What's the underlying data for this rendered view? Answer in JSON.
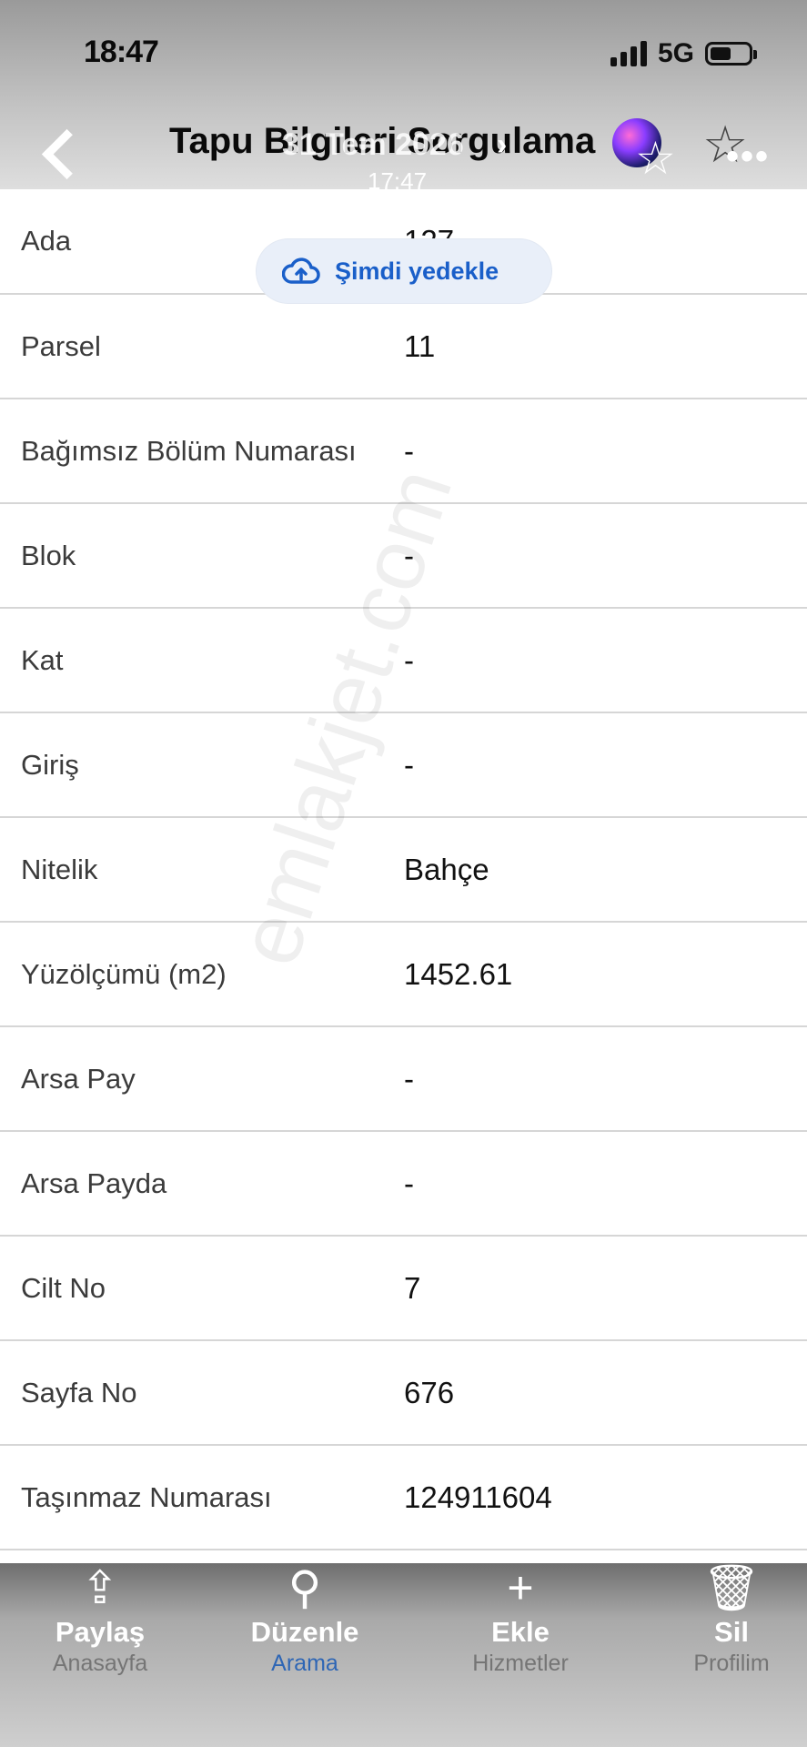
{
  "status": {
    "time": "18:47",
    "network": "5G"
  },
  "header": {
    "title": "Tapu Bilgileri Sorgulama",
    "overlay_date": "31 Tem 2026",
    "overlay_time": "17:47"
  },
  "backup": {
    "label": "Şimdi yedekle"
  },
  "rows": [
    {
      "label": "Ada",
      "value": "127"
    },
    {
      "label": "Parsel",
      "value": "11"
    },
    {
      "label": "Bağımsız Bölüm Numarası",
      "value": "-"
    },
    {
      "label": "Blok",
      "value": "-"
    },
    {
      "label": "Kat",
      "value": "-"
    },
    {
      "label": "Giriş",
      "value": "-"
    },
    {
      "label": "Nitelik",
      "value": "Bahçe"
    },
    {
      "label": "Yüzölçümü (m2)",
      "value": "1452.61"
    },
    {
      "label": "Arsa Pay",
      "value": "-"
    },
    {
      "label": "Arsa Payda",
      "value": "-"
    },
    {
      "label": "Cilt No",
      "value": "7"
    },
    {
      "label": "Sayfa No",
      "value": "676"
    },
    {
      "label": "Taşınmaz Numarası",
      "value": "124911604"
    }
  ],
  "watermark": "emlakjet.com",
  "tabs": [
    {
      "label": "Paylaş",
      "sub": "Anasayfa",
      "icon": "share-icon",
      "glyph": "⇪"
    },
    {
      "label": "Düzenle",
      "sub": "Arama",
      "icon": "edit-icon",
      "glyph": "⚲"
    },
    {
      "label": "Ekle",
      "sub": "Hizmetler",
      "icon": "plus-icon",
      "glyph": "+"
    },
    {
      "label": "Sil",
      "sub": "Profilim",
      "icon": "trash-icon",
      "glyph": "🗑"
    }
  ],
  "colors": {
    "accent": "#1a5fc9",
    "active_tab": "#2e66b5"
  }
}
